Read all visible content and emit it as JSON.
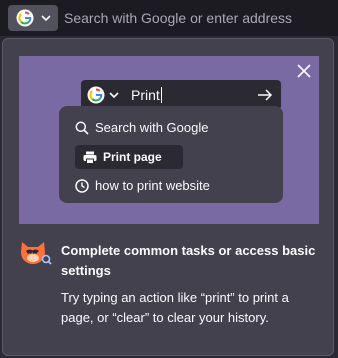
{
  "urlbar": {
    "placeholder": "Search with Google or enter address",
    "engine_icon": "google-g-icon"
  },
  "tip": {
    "illustration": {
      "query": "Print",
      "suggestions": {
        "search_label": "Search with Google",
        "action_label": "Print page",
        "history_label": "how to print website"
      }
    },
    "title": "Complete common tasks or access basic settings",
    "description": "Try typing an action like “print” to print a page, or “clear” to clear your history."
  },
  "colors": {
    "panel": "#42414d",
    "hero": "#7a6aa3",
    "toolbar": "#1c1b22",
    "text": "#fbfbfe"
  }
}
